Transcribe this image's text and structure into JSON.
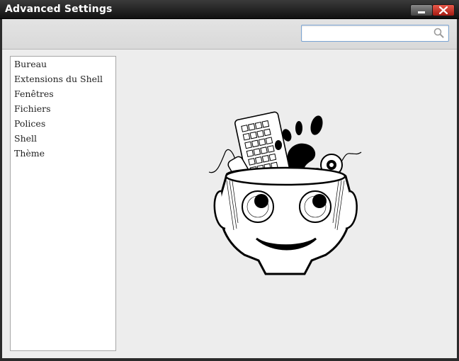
{
  "window": {
    "title": "Advanced Settings"
  },
  "search": {
    "value": "",
    "placeholder": ""
  },
  "sidebar": {
    "items": [
      {
        "label": "Bureau"
      },
      {
        "label": "Extensions du Shell"
      },
      {
        "label": "Fenêtres"
      },
      {
        "label": "Fichiers"
      },
      {
        "label": "Polices"
      },
      {
        "label": "Shell"
      },
      {
        "label": "Thème"
      }
    ]
  },
  "icons": {
    "search": "search-icon",
    "minimize": "minimize-icon",
    "close": "close-icon",
    "logo": "tweak-tool-mascot-icon"
  },
  "colors": {
    "close_button": "#c8362a",
    "search_focus_border": "#7aa4d3"
  }
}
